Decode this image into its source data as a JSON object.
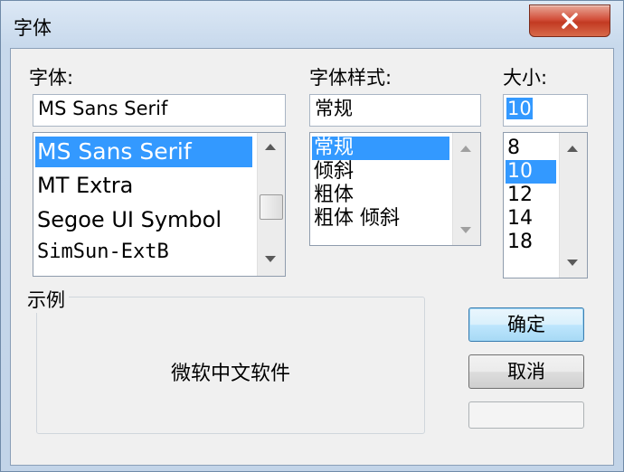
{
  "window": {
    "title": "字体"
  },
  "font": {
    "label": "字体:",
    "value": "MS Sans Serif",
    "items": [
      "MS Sans Serif",
      "MT Extra",
      "Segoe UI Symbol",
      "SimSun-ExtB"
    ]
  },
  "style": {
    "label": "字体样式:",
    "value": "常规",
    "items": [
      "常规",
      "倾斜",
      "粗体",
      "粗体 倾斜"
    ]
  },
  "size": {
    "label": "大小:",
    "value": "10",
    "items": [
      "8",
      "10",
      "12",
      "14",
      "18"
    ]
  },
  "sample": {
    "label": "示例",
    "text": "微软中文软件"
  },
  "buttons": {
    "ok": "确定",
    "cancel": "取消",
    "third": ""
  },
  "colors": {
    "selection": "#3399ff",
    "close": "#c23a22"
  }
}
